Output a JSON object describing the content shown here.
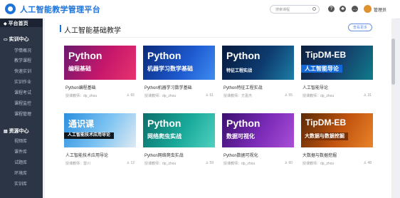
{
  "app": {
    "title": "人工智能教学管理平台"
  },
  "header": {
    "search_placeholder": "搜索课程",
    "help_glyph": "?",
    "notify_glyph": "♣",
    "chat_glyph": "…",
    "user_name": "管理员"
  },
  "sidebar": {
    "home": "平台首页",
    "teaching": {
      "label": "实训中心",
      "items": [
        "学情概况",
        "教学课程",
        "快速实训",
        "实训作业",
        "课程考试",
        "课程监控",
        "课程管理"
      ]
    },
    "resource": {
      "label": "资源中心",
      "items": [
        "视频库",
        "课件库",
        "试题库",
        "环境库",
        "实训库"
      ]
    }
  },
  "section": {
    "title": "人工智能基础教学",
    "more_label": "查看更多"
  },
  "courses": [
    {
      "cover_title": "Python",
      "cover_sub": "编程基础",
      "name": "Python编程基础",
      "teacher": "授课教师：dp_zhou",
      "students": "65"
    },
    {
      "cover_title": "Python",
      "cover_sub": "机器学习数学基础",
      "name": "Python机器学习数学基础",
      "teacher": "授课教师：dp_zhou",
      "students": "61"
    },
    {
      "cover_title": "Python",
      "cover_sub": "特征工程实战",
      "name": "Python特征工程实战",
      "teacher": "授课教师：方嘉杰",
      "students": "55"
    },
    {
      "cover_title": "TipDM-EB",
      "cover_sub": "人工智能导论",
      "name": "人工智能导论",
      "teacher": "授课教师：dp_zhou",
      "students": "31"
    },
    {
      "cover_title": "通识课",
      "cover_sub": "人工智能技术应用导论",
      "name": "人工智能技术应用导论",
      "teacher": "授课教师：雷川",
      "students": "12"
    },
    {
      "cover_title": "Python",
      "cover_sub": "网络爬虫实战",
      "name": "Python网络爬虫实战",
      "teacher": "授课教师：dp_zhou",
      "students": "59"
    },
    {
      "cover_title": "Python",
      "cover_sub": "数据可视化",
      "name": "Python数据可视化",
      "teacher": "授课教师：dp_zhou",
      "students": "60"
    },
    {
      "cover_title": "TipDM-EB",
      "cover_sub": "大数据与数据挖掘",
      "name": "大数据与数据挖掘",
      "teacher": "授课教师：dp_zhou",
      "students": "48"
    }
  ],
  "colors": {
    "accent": "#1e73d8",
    "sidebar": "#2b3546"
  }
}
